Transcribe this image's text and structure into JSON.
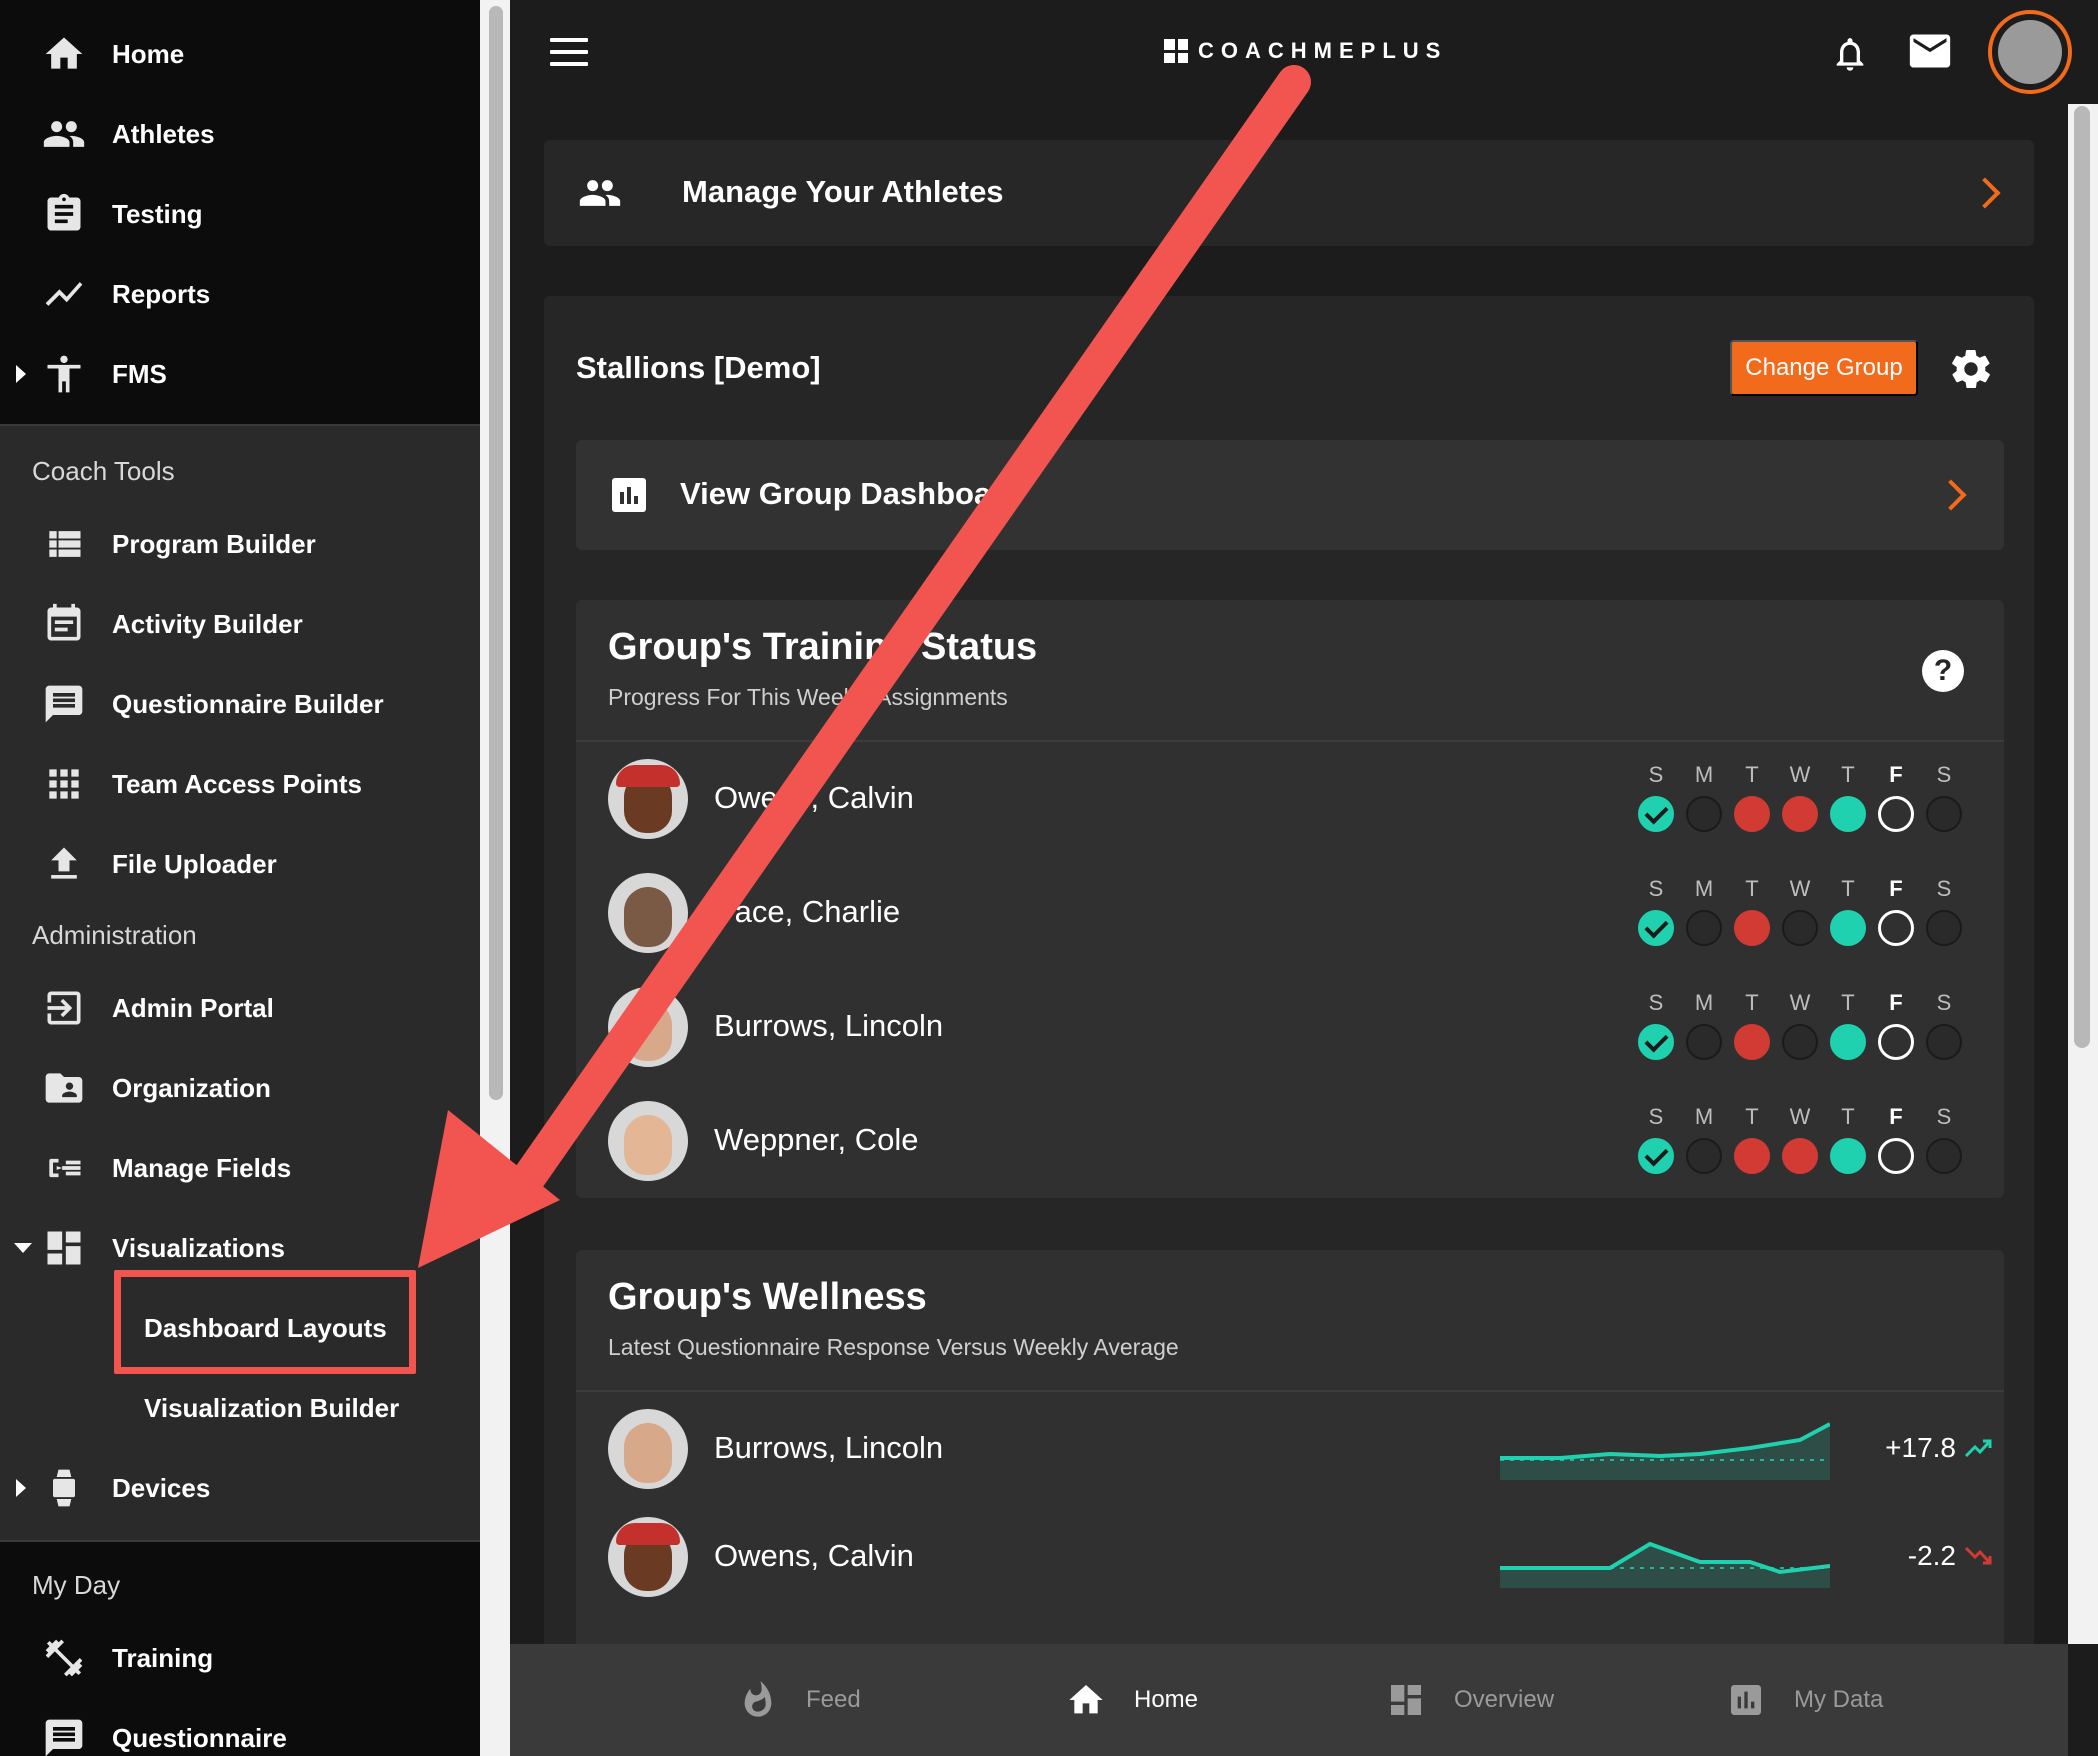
{
  "app": {
    "logo_text": "COACHMEPLUS"
  },
  "sidebar": {
    "primary": [
      {
        "label": "Home",
        "icon": "home-icon"
      },
      {
        "label": "Athletes",
        "icon": "athletes-icon"
      },
      {
        "label": "Testing",
        "icon": "clipboard-icon"
      },
      {
        "label": "Reports",
        "icon": "trend-line-icon"
      },
      {
        "label": "FMS",
        "icon": "person-icon"
      }
    ],
    "coach_tools_header": "Coach Tools",
    "coach_tools": [
      {
        "label": "Program Builder",
        "icon": "list-icon"
      },
      {
        "label": "Activity Builder",
        "icon": "calendar-icon"
      },
      {
        "label": "Questionnaire Builder",
        "icon": "message-icon"
      },
      {
        "label": "Team Access Points",
        "icon": "grid-icon"
      },
      {
        "label": "File Uploader",
        "icon": "upload-icon"
      }
    ],
    "administration_header": "Administration",
    "administration": [
      {
        "label": "Admin Portal",
        "icon": "login-icon"
      },
      {
        "label": "Organization",
        "icon": "folder-person-icon"
      },
      {
        "label": "Manage Fields",
        "icon": "fields-icon"
      },
      {
        "label": "Visualizations",
        "icon": "dashboard-icon"
      }
    ],
    "visualizations_sub": [
      {
        "label": "Dashboard Layouts"
      },
      {
        "label": "Visualization Builder"
      }
    ],
    "devices": {
      "label": "Devices",
      "icon": "watch-icon"
    },
    "my_day_header": "My Day",
    "my_day": [
      {
        "label": "Training",
        "icon": "dumbbell-icon"
      },
      {
        "label": "Questionnaire",
        "icon": "message-icon"
      }
    ]
  },
  "main": {
    "manage_athletes": "Manage Your Athletes",
    "group_name": "Stallions [Demo]",
    "change_group": "Change Group",
    "view_dashboard": "View Group Dashboard",
    "training_status": {
      "title": "Group's Training Status",
      "subtitle": "Progress For This Week's Assignments",
      "day_letters": [
        "S",
        "M",
        "T",
        "W",
        "T",
        "F",
        "S"
      ],
      "today_index": 5,
      "athletes": [
        {
          "name": "Owens, Calvin",
          "days": [
            "check",
            "none",
            "missed",
            "missed",
            "done",
            "today",
            "none"
          ],
          "cap": true,
          "skin": "#6b3a22"
        },
        {
          "name": "Pace, Charlie",
          "days": [
            "check",
            "none",
            "missed",
            "none",
            "done",
            "today",
            "none"
          ],
          "cap": false,
          "skin": "#7a5a44"
        },
        {
          "name": "Burrows, Lincoln",
          "days": [
            "check",
            "none",
            "missed",
            "none",
            "done",
            "today",
            "none"
          ],
          "cap": false,
          "skin": "#d8a88a"
        },
        {
          "name": "Weppner, Cole",
          "days": [
            "check",
            "none",
            "missed",
            "missed",
            "done",
            "today",
            "none"
          ],
          "cap": false,
          "skin": "#e3b696"
        }
      ]
    },
    "wellness": {
      "title": "Group's Wellness",
      "subtitle": "Latest Questionnaire Response Versus Weekly Average",
      "athletes": [
        {
          "name": "Burrows, Lincoln",
          "delta": "+17.8",
          "direction": "up",
          "skin": "#d8a88a",
          "cap": false
        },
        {
          "name": "Owens, Calvin",
          "delta": "-2.2",
          "direction": "down",
          "skin": "#6b3a22",
          "cap": true
        }
      ]
    }
  },
  "bottom_nav": [
    {
      "label": "Feed",
      "icon": "flame-icon",
      "active": false
    },
    {
      "label": "Home",
      "icon": "home-icon",
      "active": true
    },
    {
      "label": "Overview",
      "icon": "dashboard-icon",
      "active": false
    },
    {
      "label": "My Data",
      "icon": "bar-chart-icon",
      "active": false
    }
  ],
  "colors": {
    "accent": "#f26a1b",
    "done": "#1fd1ae",
    "missed": "#d13b34",
    "annotation": "#f25550"
  }
}
